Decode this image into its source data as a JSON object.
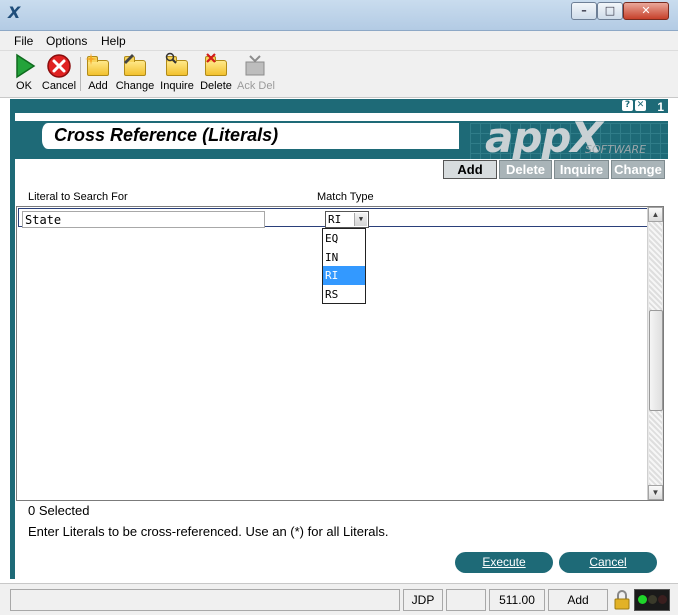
{
  "window": {
    "app_glyph": "X",
    "btn_minimize": "–",
    "btn_restore": "□",
    "btn_close": "✕"
  },
  "menu": {
    "items": [
      "File",
      "Options",
      "Help"
    ]
  },
  "toolbar": {
    "ok": "OK",
    "cancel": "Cancel",
    "add": "Add",
    "change": "Change",
    "inquire": "Inquire",
    "delete": "Delete",
    "ack_del": "Ack Del"
  },
  "frame": {
    "help": "?",
    "close": "✕",
    "number": "1"
  },
  "header": {
    "title": "Cross Reference (Literals)",
    "logo": "appX",
    "logo_sub": "SOFTWARE"
  },
  "mode_tabs": [
    "Add",
    "Delete",
    "Inquire",
    "Change"
  ],
  "form": {
    "literal_label": "Literal to Search For",
    "match_label": "Match Type",
    "literal_value": "State",
    "match_value": "RI",
    "match_options": [
      "EQ",
      "IN",
      "RI",
      "RS"
    ],
    "match_selected": "RI"
  },
  "footer": {
    "selected_count": "0 Selected",
    "instructions": "Enter Literals to be cross-referenced. Use an (*) for all Literals.",
    "execute": "Execute",
    "cancel": "Cancel"
  },
  "status": {
    "user": "JDP",
    "version": "511.00",
    "mode": "Add"
  },
  "colors": {
    "accent": "#1e6a77",
    "dropdown_highlight": "#3399ff"
  },
  "icons": [
    "ok-icon",
    "cancel-icon",
    "add-icon",
    "change-icon",
    "inquire-icon",
    "delete-icon",
    "ack-del-icon",
    "help-icon",
    "lock-icon",
    "traffic-lights-icon"
  ]
}
